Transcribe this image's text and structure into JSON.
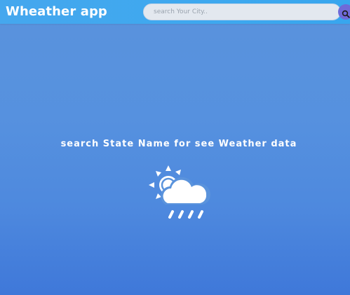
{
  "header": {
    "app_title": "Wheather app",
    "search_placeholder": "search Your City..",
    "search_icon": "search-icon"
  },
  "main": {
    "message": "search State Name for see Weather data",
    "weather_icon": "partly-cloudy-rain-icon"
  },
  "colors": {
    "navbar": "#3ea8ef",
    "background_top": "#5a93dc",
    "background_bottom": "#3f78d9",
    "search_button": "#6f6ad8",
    "text": "#ffffff"
  }
}
